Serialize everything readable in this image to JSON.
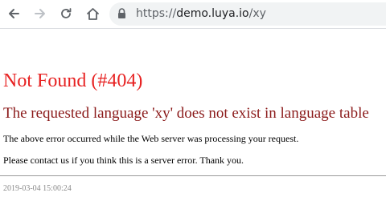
{
  "browser": {
    "url_scheme": "https://",
    "url_host": "demo.luya.io",
    "url_path": "/xy",
    "icons": {
      "back": "arrow-left-icon",
      "forward": "arrow-right-icon",
      "reload": "reload-icon",
      "home": "home-icon",
      "lock": "lock-icon"
    },
    "colors": {
      "omnibox_bg": "#f1f3f4",
      "icon": "#5f6368",
      "icon_disabled": "#bdc1c6"
    }
  },
  "page": {
    "title": "Not Found (#404)",
    "message": "The requested language 'xy' does not exist in language table",
    "note_1": "The above error occurred while the Web server was processing your request.",
    "note_2": "Please contact us if you think this is a server error. Thank you.",
    "timestamp": "2019-03-04 15:00:24",
    "colors": {
      "title": "#e72222",
      "message": "#8b1a1a",
      "timestamp": "#8a8a8a"
    }
  }
}
